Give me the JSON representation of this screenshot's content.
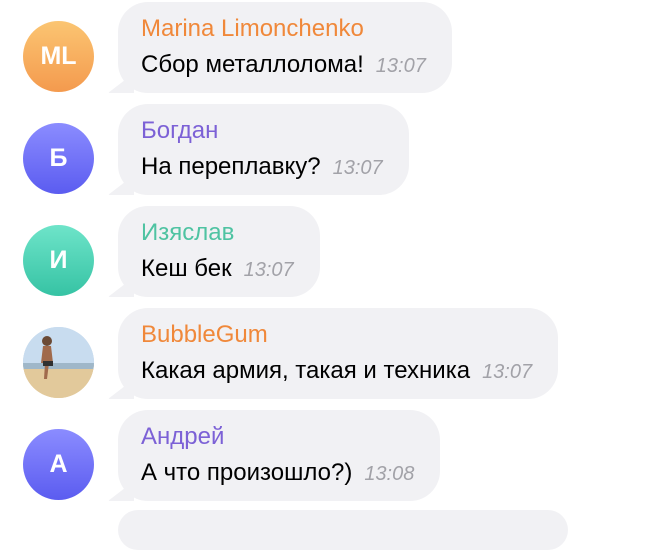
{
  "messages": [
    {
      "avatar_initials": "ML",
      "author": "Marina Limonchenko",
      "author_color": "#f0883a",
      "text": "Сбор металлолома!",
      "time": "13:07"
    },
    {
      "avatar_initials": "Б",
      "author": "Богдан",
      "author_color": "#7c61d6",
      "text": "На переплавку?",
      "time": "13:07"
    },
    {
      "avatar_initials": "И",
      "author": "Изяслав",
      "author_color": "#4fc3a2",
      "text": "Кеш бек",
      "time": "13:07"
    },
    {
      "avatar_initials": "",
      "author": "BubbleGum",
      "author_color": "#f0883a",
      "text": "Какая армия, такая и техника",
      "time": "13:07"
    },
    {
      "avatar_initials": "А",
      "author": "Андрей",
      "author_color": "#7c61d6",
      "text": "А что произошло?)",
      "time": "13:08"
    }
  ]
}
